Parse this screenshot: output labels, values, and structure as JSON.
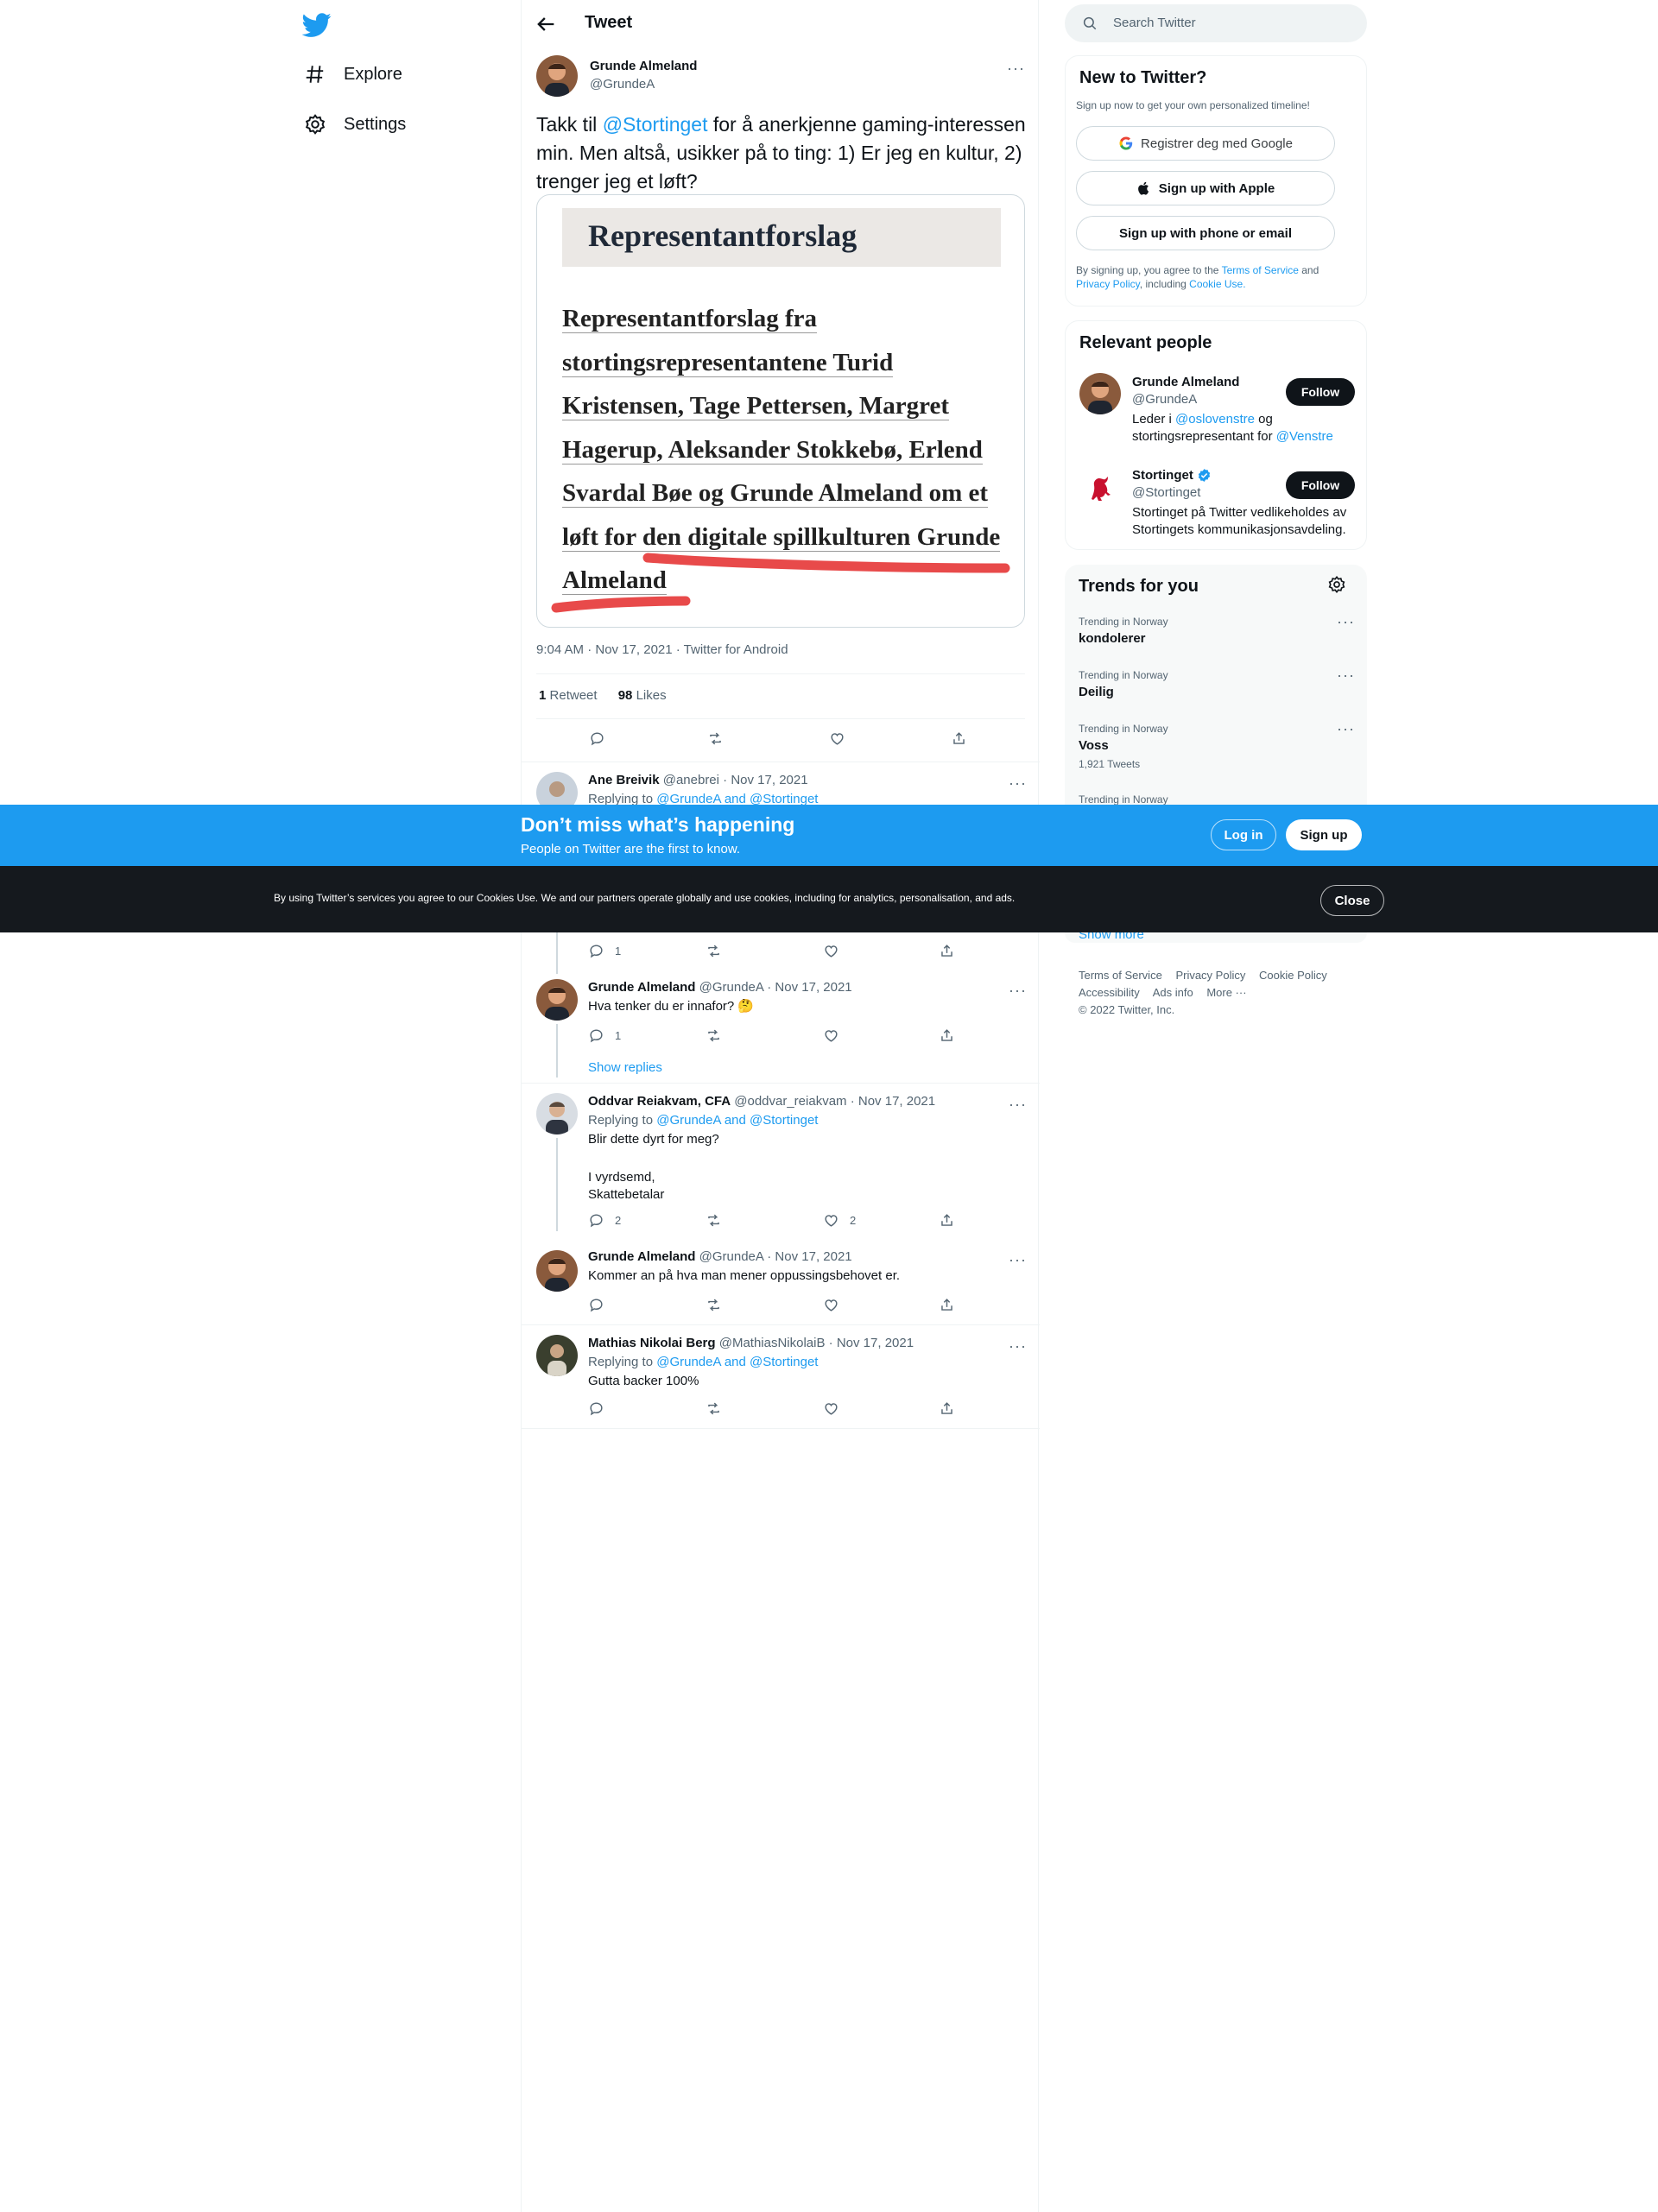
{
  "nav": {
    "logo": "twitter-bird-icon",
    "items": [
      {
        "label": "Explore",
        "icon": "hashtag-icon"
      },
      {
        "label": "Settings",
        "icon": "gear-icon"
      }
    ]
  },
  "main": {
    "title": "Tweet",
    "tweet": {
      "author_name": "Grunde Almeland",
      "author_handle": "@GrundeA",
      "text_before": "Takk til ",
      "mention": "@Stortinget",
      "text_after": " for å anerkjenne gaming-interessen min. Men altså, usikker på to ting: 1) Er jeg en kultur, 2) trenger jeg et løft?",
      "image": {
        "heading": "Representantforslag",
        "lines": [
          "Representantforslag fra",
          "stortingsrepresentantene Turid",
          "Kristensen, Tage Pettersen, Margret",
          "Hagerup, Aleksander Stokkebø, Erlend",
          "Svardal Bøe og Grunde Almeland om et",
          "løft for den digitale spillkulturen Grunde",
          "Almeland"
        ]
      },
      "meta": "9:04 AM · Nov 17, 2021 · Twitter for Android",
      "retweets": "1",
      "retweets_label": "Retweet",
      "likes": "98",
      "likes_label": "Likes"
    },
    "replies": [
      {
        "name": "Ane Breivik",
        "handle": "@anebrei",
        "date": "· Nov 17, 2021",
        "replying_prefix": "Replying to",
        "replying_to": "@GrundeA and @Stortinget"
      },
      {
        "reply_count": "1"
      },
      {
        "name": "Grunde Almeland",
        "handle": "@GrundeA",
        "date": "· Nov 17, 2021",
        "text": "Hva tenker du er innafor? 🤔",
        "reply_count": "1",
        "show_replies": "Show replies"
      },
      {
        "name": "Oddvar Reiakvam, CFA",
        "handle": "@oddvar_reiakvam",
        "date": "· Nov 17, 2021",
        "replying_prefix": "Replying to",
        "replying_to": "@GrundeA and @Stortinget",
        "text_lines": [
          "Blir dette dyrt for meg?",
          "",
          "I vyrdsemd,",
          "Skattebetalar"
        ],
        "reply_count": "2",
        "like_count": "2"
      },
      {
        "name": "Grunde Almeland",
        "handle": "@GrundeA",
        "date": "· Nov 17, 2021",
        "text": "Kommer an på hva man mener oppussingsbehovet er."
      },
      {
        "name": "Mathias Nikolai Berg",
        "handle": "@MathiasNikolaiB",
        "date": "· Nov 17, 2021",
        "replying_prefix": "Replying to",
        "replying_to": "@GrundeA and @Stortinget",
        "text": "Gutta backer 100%"
      }
    ]
  },
  "right": {
    "search_placeholder": "Search Twitter",
    "new": {
      "title": "New to Twitter?",
      "subtitle": "Sign up now to get your own personalized timeline!",
      "google": "Registrer deg med Google",
      "apple": "Sign up with Apple",
      "phone": "Sign up with phone or email",
      "legal_1": "By signing up, you agree to the ",
      "tos": "Terms of Service",
      "legal_2": " and ",
      "privacy": "Privacy Policy",
      "legal_3": ", including ",
      "cookie": "Cookie Use."
    },
    "relevant": {
      "title": "Relevant people",
      "people": [
        {
          "name": "Grunde Almeland",
          "handle": "@GrundeA",
          "bio_1": "Leder i ",
          "bio_link_1": "@oslovenstre",
          "bio_2": " og stortingsrepresentant for ",
          "bio_link_2": "@Venstre",
          "follow": "Follow"
        },
        {
          "name": "Stortinget",
          "handle": "@Stortinget",
          "bio": "Stortinget på Twitter vedlikeholdes av Stortingets kommunikasjonsavdeling.",
          "follow": "Follow",
          "verified": true
        }
      ]
    },
    "trends": {
      "title": "Trends for you",
      "items": [
        {
          "context": "Trending in Norway",
          "name": "kondolerer"
        },
        {
          "context": "Trending in Norway",
          "name": "Deilig"
        },
        {
          "context": "Trending in Norway",
          "name": "Voss",
          "count": "1,921 Tweets"
        },
        {
          "context": "Trending in Norway"
        }
      ],
      "show_more": "Show more"
    },
    "footer": {
      "links_row1": [
        "Terms of Service",
        "Privacy Policy",
        "Cookie Policy"
      ],
      "links_row2": [
        "Accessibility",
        "Ads info",
        "More ···"
      ],
      "copyright": "© 2022 Twitter, Inc."
    }
  },
  "banner": {
    "title": "Don’t miss what’s happening",
    "subtitle": "People on Twitter are the first to know.",
    "login": "Log in",
    "signup": "Sign up"
  },
  "cookie": {
    "text": "By using Twitter’s services you agree to our Cookies Use. We and our partners operate globally and use cookies, including for analytics, personalisation, and ads.",
    "close": "Close"
  },
  "colors": {
    "accent": "#1d9bf0",
    "text": "#0f1419",
    "muted": "#536471",
    "cookie_bg": "#15191e",
    "highlight_red": "#e84a4a"
  }
}
